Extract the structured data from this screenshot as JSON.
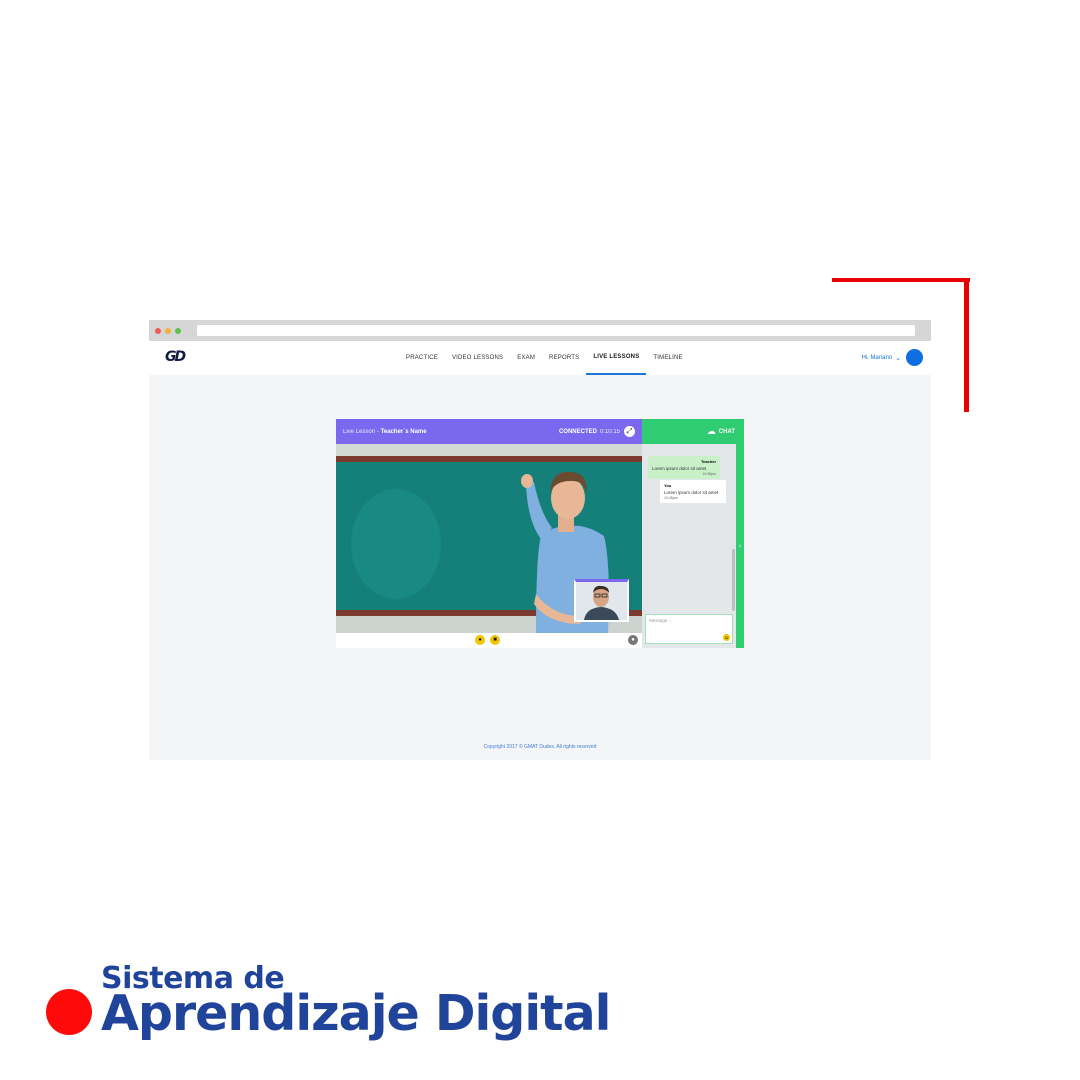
{
  "nav": {
    "logo": "GD",
    "items": [
      {
        "label": "PRACTICE",
        "active": false
      },
      {
        "label": "VIDEO LESSONS",
        "active": false
      },
      {
        "label": "EXAM",
        "active": false
      },
      {
        "label": "REPORTS",
        "active": false
      },
      {
        "label": "LIVE LESSONS",
        "active": true
      },
      {
        "label": "TIMELINE",
        "active": false
      }
    ],
    "user_greeting": "Hi, Mariano"
  },
  "lesson": {
    "title_prefix": "Live Lesson - ",
    "teacher_name": "Teacher´s Name",
    "status": "CONNECTED",
    "elapsed": "0:10:15"
  },
  "chat": {
    "title": "CHAT",
    "messages": [
      {
        "from": "Teacher",
        "text": "Lorem ipsum dolor sit amet",
        "time": "10:45pm"
      },
      {
        "from": "You",
        "text": "Lorem ipsum dolor sit amet",
        "time": "10:45pm"
      }
    ],
    "input_placeholder": "Message..."
  },
  "footer": {
    "text": "Copyright 2017 © GMAT Dudes. All rights reserved"
  },
  "heading": {
    "line1": "Sistema de",
    "line2": "Aprendizaje Digital"
  },
  "colors": {
    "accent_red": "#e60000",
    "header_purple": "#7b68ee",
    "chat_green": "#2fcc71",
    "heading_blue": "#21449b",
    "link_blue": "#1976d2"
  },
  "icons": {
    "mic": "microphone-icon",
    "camera": "camera-icon",
    "chat_toggle": "chat-bubble-icon",
    "expand": "expand-icon",
    "emoji": "emoji-icon"
  }
}
